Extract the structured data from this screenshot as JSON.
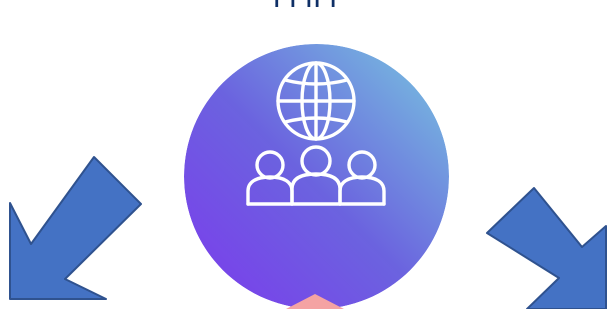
{
  "diagram": {
    "top_text": "Ⅰ Ⅰ ⅠⅠ Ⅰ",
    "hub_icon": "globe-people-icon",
    "left_arrow_icon": "arrow-down-left-icon",
    "right_arrow_icon": "arrow-down-right-icon",
    "bottom_shape_icon": "pink-peak-icon",
    "colors": {
      "hub_gradient_start": "#7c3aed",
      "hub_gradient_mid": "#6b63df",
      "hub_gradient_end": "#78c9df",
      "arrow_fill": "#4472c4",
      "arrow_stroke": "#2f528f",
      "bottom_shape": "#f4a3a3",
      "top_text": "#0f2f66"
    }
  }
}
